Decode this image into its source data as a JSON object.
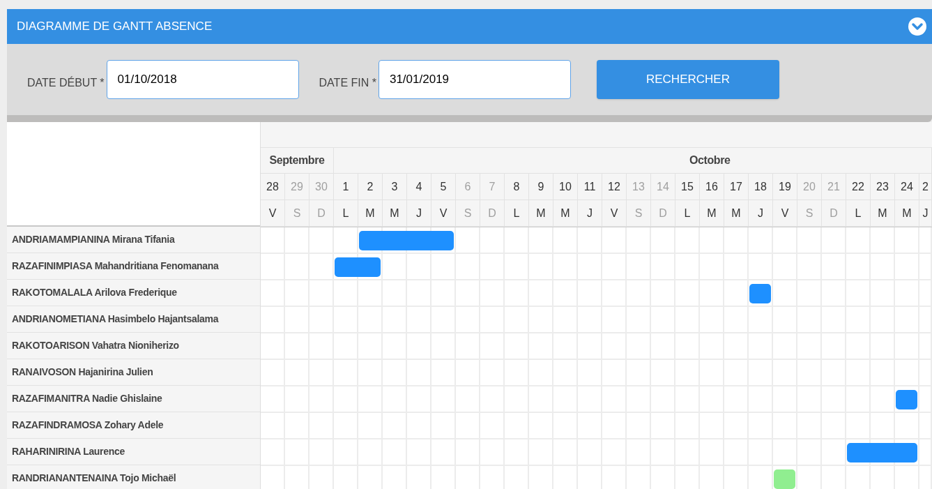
{
  "panel": {
    "title": "DIAGRAMME DE GANTT ABSENCE",
    "expanded": true
  },
  "form": {
    "fields": [
      {
        "label": "DATE DÉBUT",
        "required_mark": "*",
        "value": "01/10/2018"
      },
      {
        "label": "DATE FIN",
        "required_mark": "*",
        "value": "31/01/2019"
      }
    ],
    "button": "RECHERCHER"
  },
  "gantt": {
    "months": [
      {
        "name": "Septembre",
        "days": [
          {
            "day": "28",
            "weekday": "V",
            "weekend": false
          },
          {
            "day": "29",
            "weekday": "S",
            "weekend": true
          },
          {
            "day": "30",
            "weekday": "D",
            "weekend": true
          }
        ]
      },
      {
        "name": "Octobre",
        "days": [
          {
            "day": "1",
            "weekday": "L",
            "weekend": false
          },
          {
            "day": "2",
            "weekday": "M",
            "weekend": false
          },
          {
            "day": "3",
            "weekday": "M",
            "weekend": false
          },
          {
            "day": "4",
            "weekday": "J",
            "weekend": false
          },
          {
            "day": "5",
            "weekday": "V",
            "weekend": false
          },
          {
            "day": "6",
            "weekday": "S",
            "weekend": true
          },
          {
            "day": "7",
            "weekday": "D",
            "weekend": true
          },
          {
            "day": "8",
            "weekday": "L",
            "weekend": false
          },
          {
            "day": "9",
            "weekday": "M",
            "weekend": false
          },
          {
            "day": "10",
            "weekday": "M",
            "weekend": false
          },
          {
            "day": "11",
            "weekday": "J",
            "weekend": false
          },
          {
            "day": "12",
            "weekday": "V",
            "weekend": false
          },
          {
            "day": "13",
            "weekday": "S",
            "weekend": true
          },
          {
            "day": "14",
            "weekday": "D",
            "weekend": true
          },
          {
            "day": "15",
            "weekday": "L",
            "weekend": false
          },
          {
            "day": "16",
            "weekday": "M",
            "weekend": false
          },
          {
            "day": "17",
            "weekday": "M",
            "weekend": false
          },
          {
            "day": "18",
            "weekday": "J",
            "weekend": false
          },
          {
            "day": "19",
            "weekday": "V",
            "weekend": false
          },
          {
            "day": "20",
            "weekday": "S",
            "weekend": true
          },
          {
            "day": "21",
            "weekday": "D",
            "weekend": true
          },
          {
            "day": "22",
            "weekday": "L",
            "weekend": false
          },
          {
            "day": "23",
            "weekday": "M",
            "weekend": false
          },
          {
            "day": "24",
            "weekday": "M",
            "weekend": false
          },
          {
            "day": "2",
            "weekday": "J",
            "weekend": false
          }
        ]
      }
    ],
    "rows": [
      {
        "name": "ANDRIAMAMPIANINA Mirana Tifania",
        "cells": [
          {
            "absent": false
          },
          {
            "absent": false
          },
          {
            "absent": false
          },
          {
            "absent": false
          },
          {
            "absent": true,
            "color": "#1e90ff"
          },
          {
            "absent": true,
            "color": "#1e90ff"
          },
          {
            "absent": true,
            "color": "#1e90ff"
          },
          {
            "absent": true,
            "color": "#1e90ff"
          },
          {
            "absent": false
          },
          {
            "absent": false
          },
          {
            "absent": false
          },
          {
            "absent": false
          },
          {
            "absent": false
          },
          {
            "absent": false
          },
          {
            "absent": false
          },
          {
            "absent": false
          },
          {
            "absent": false
          },
          {
            "absent": false
          },
          {
            "absent": false
          },
          {
            "absent": false
          },
          {
            "absent": false
          },
          {
            "absent": false
          },
          {
            "absent": false
          },
          {
            "absent": false
          },
          {
            "absent": false
          },
          {
            "absent": false
          },
          {
            "absent": false
          },
          {
            "absent": false
          }
        ]
      },
      {
        "name": "RAZAFINIMPIASA Mahandritiana Fenomanana",
        "cells": [
          {
            "absent": false
          },
          {
            "absent": false
          },
          {
            "absent": false
          },
          {
            "absent": true,
            "color": "#1e90ff"
          },
          {
            "absent": true,
            "color": "#1e90ff"
          },
          {
            "absent": false
          },
          {
            "absent": false
          },
          {
            "absent": false
          },
          {
            "absent": false
          },
          {
            "absent": false
          },
          {
            "absent": false
          },
          {
            "absent": false
          },
          {
            "absent": false
          },
          {
            "absent": false
          },
          {
            "absent": false
          },
          {
            "absent": false
          },
          {
            "absent": false
          },
          {
            "absent": false
          },
          {
            "absent": false
          },
          {
            "absent": false
          },
          {
            "absent": false
          },
          {
            "absent": false
          },
          {
            "absent": false
          },
          {
            "absent": false
          },
          {
            "absent": false
          },
          {
            "absent": false
          },
          {
            "absent": false
          },
          {
            "absent": false
          }
        ]
      },
      {
        "name": "RAKOTOMALALA Arilova Frederique",
        "cells": [
          {
            "absent": false
          },
          {
            "absent": false
          },
          {
            "absent": false
          },
          {
            "absent": false
          },
          {
            "absent": false
          },
          {
            "absent": false
          },
          {
            "absent": false
          },
          {
            "absent": false
          },
          {
            "absent": false
          },
          {
            "absent": false
          },
          {
            "absent": false
          },
          {
            "absent": false
          },
          {
            "absent": false
          },
          {
            "absent": false
          },
          {
            "absent": false
          },
          {
            "absent": false
          },
          {
            "absent": false
          },
          {
            "absent": false
          },
          {
            "absent": false
          },
          {
            "absent": false
          },
          {
            "absent": true,
            "color": "#1e90ff"
          },
          {
            "absent": false
          },
          {
            "absent": false
          },
          {
            "absent": false
          },
          {
            "absent": false
          },
          {
            "absent": false
          },
          {
            "absent": false
          },
          {
            "absent": false
          }
        ]
      },
      {
        "name": "ANDRIANOMETIANA Hasimbelo Hajantsalama",
        "cells": [
          {
            "absent": false
          },
          {
            "absent": false
          },
          {
            "absent": false
          },
          {
            "absent": false
          },
          {
            "absent": false
          },
          {
            "absent": false
          },
          {
            "absent": false
          },
          {
            "absent": false
          },
          {
            "absent": false
          },
          {
            "absent": false
          },
          {
            "absent": false
          },
          {
            "absent": false
          },
          {
            "absent": false
          },
          {
            "absent": false
          },
          {
            "absent": false
          },
          {
            "absent": false
          },
          {
            "absent": false
          },
          {
            "absent": false
          },
          {
            "absent": false
          },
          {
            "absent": false
          },
          {
            "absent": false
          },
          {
            "absent": false
          },
          {
            "absent": false
          },
          {
            "absent": false
          },
          {
            "absent": false
          },
          {
            "absent": false
          },
          {
            "absent": false
          },
          {
            "absent": false
          }
        ]
      },
      {
        "name": "RAKOTOARISON Vahatra Nioniherizo",
        "cells": [
          {
            "absent": false
          },
          {
            "absent": false
          },
          {
            "absent": false
          },
          {
            "absent": false
          },
          {
            "absent": false
          },
          {
            "absent": false
          },
          {
            "absent": false
          },
          {
            "absent": false
          },
          {
            "absent": false
          },
          {
            "absent": false
          },
          {
            "absent": false
          },
          {
            "absent": false
          },
          {
            "absent": false
          },
          {
            "absent": false
          },
          {
            "absent": false
          },
          {
            "absent": false
          },
          {
            "absent": false
          },
          {
            "absent": false
          },
          {
            "absent": false
          },
          {
            "absent": false
          },
          {
            "absent": false
          },
          {
            "absent": false
          },
          {
            "absent": false
          },
          {
            "absent": false
          },
          {
            "absent": false
          },
          {
            "absent": false
          },
          {
            "absent": false
          },
          {
            "absent": false
          }
        ]
      },
      {
        "name": "RANAIVOSON Hajanirina Julien",
        "cells": [
          {
            "absent": false
          },
          {
            "absent": false
          },
          {
            "absent": false
          },
          {
            "absent": false
          },
          {
            "absent": false
          },
          {
            "absent": false
          },
          {
            "absent": false
          },
          {
            "absent": false
          },
          {
            "absent": false
          },
          {
            "absent": false
          },
          {
            "absent": false
          },
          {
            "absent": false
          },
          {
            "absent": false
          },
          {
            "absent": false
          },
          {
            "absent": false
          },
          {
            "absent": false
          },
          {
            "absent": false
          },
          {
            "absent": false
          },
          {
            "absent": false
          },
          {
            "absent": false
          },
          {
            "absent": false
          },
          {
            "absent": false
          },
          {
            "absent": false
          },
          {
            "absent": false
          },
          {
            "absent": false
          },
          {
            "absent": false
          },
          {
            "absent": false
          },
          {
            "absent": false
          }
        ]
      },
      {
        "name": "RAZAFIMANITRA Nadie Ghislaine",
        "cells": [
          {
            "absent": false
          },
          {
            "absent": false
          },
          {
            "absent": false
          },
          {
            "absent": false
          },
          {
            "absent": false
          },
          {
            "absent": false
          },
          {
            "absent": false
          },
          {
            "absent": false
          },
          {
            "absent": false
          },
          {
            "absent": false
          },
          {
            "absent": false
          },
          {
            "absent": false
          },
          {
            "absent": false
          },
          {
            "absent": false
          },
          {
            "absent": false
          },
          {
            "absent": false
          },
          {
            "absent": false
          },
          {
            "absent": false
          },
          {
            "absent": false
          },
          {
            "absent": false
          },
          {
            "absent": false
          },
          {
            "absent": false
          },
          {
            "absent": false
          },
          {
            "absent": false
          },
          {
            "absent": false
          },
          {
            "absent": false
          },
          {
            "absent": true,
            "color": "#1e90ff"
          },
          {
            "absent": false
          }
        ]
      },
      {
        "name": "RAZAFINDRAMOSA Zohary Adele",
        "cells": [
          {
            "absent": false
          },
          {
            "absent": false
          },
          {
            "absent": false
          },
          {
            "absent": false
          },
          {
            "absent": false
          },
          {
            "absent": false
          },
          {
            "absent": false
          },
          {
            "absent": false
          },
          {
            "absent": false
          },
          {
            "absent": false
          },
          {
            "absent": false
          },
          {
            "absent": false
          },
          {
            "absent": false
          },
          {
            "absent": false
          },
          {
            "absent": false
          },
          {
            "absent": false
          },
          {
            "absent": false
          },
          {
            "absent": false
          },
          {
            "absent": false
          },
          {
            "absent": false
          },
          {
            "absent": false
          },
          {
            "absent": false
          },
          {
            "absent": false
          },
          {
            "absent": false
          },
          {
            "absent": false
          },
          {
            "absent": false
          },
          {
            "absent": false
          },
          {
            "absent": false
          }
        ]
      },
      {
        "name": "RAHARINIRINA Laurence",
        "cells": [
          {
            "absent": false
          },
          {
            "absent": false
          },
          {
            "absent": false
          },
          {
            "absent": false
          },
          {
            "absent": false
          },
          {
            "absent": false
          },
          {
            "absent": false
          },
          {
            "absent": false
          },
          {
            "absent": false
          },
          {
            "absent": false
          },
          {
            "absent": false
          },
          {
            "absent": false
          },
          {
            "absent": false
          },
          {
            "absent": false
          },
          {
            "absent": false
          },
          {
            "absent": false
          },
          {
            "absent": false
          },
          {
            "absent": false
          },
          {
            "absent": false
          },
          {
            "absent": false
          },
          {
            "absent": false
          },
          {
            "absent": false
          },
          {
            "absent": false
          },
          {
            "absent": false
          },
          {
            "absent": true,
            "color": "#1e90ff"
          },
          {
            "absent": true,
            "color": "#1e90ff"
          },
          {
            "absent": true,
            "color": "#1e90ff"
          },
          {
            "absent": false
          }
        ]
      },
      {
        "name": "RANDRIANANTENAINA Tojo Michaël",
        "cells": [
          {
            "absent": false
          },
          {
            "absent": false
          },
          {
            "absent": false
          },
          {
            "absent": false
          },
          {
            "absent": false
          },
          {
            "absent": false
          },
          {
            "absent": false
          },
          {
            "absent": false
          },
          {
            "absent": false
          },
          {
            "absent": false
          },
          {
            "absent": false
          },
          {
            "absent": false
          },
          {
            "absent": false
          },
          {
            "absent": false
          },
          {
            "absent": false
          },
          {
            "absent": false
          },
          {
            "absent": false
          },
          {
            "absent": false
          },
          {
            "absent": false
          },
          {
            "absent": false
          },
          {
            "absent": false
          },
          {
            "absent": true,
            "color": "#90ee90"
          },
          {
            "absent": false
          },
          {
            "absent": false
          },
          {
            "absent": false
          },
          {
            "absent": false
          },
          {
            "absent": false
          },
          {
            "absent": false
          }
        ]
      }
    ]
  }
}
